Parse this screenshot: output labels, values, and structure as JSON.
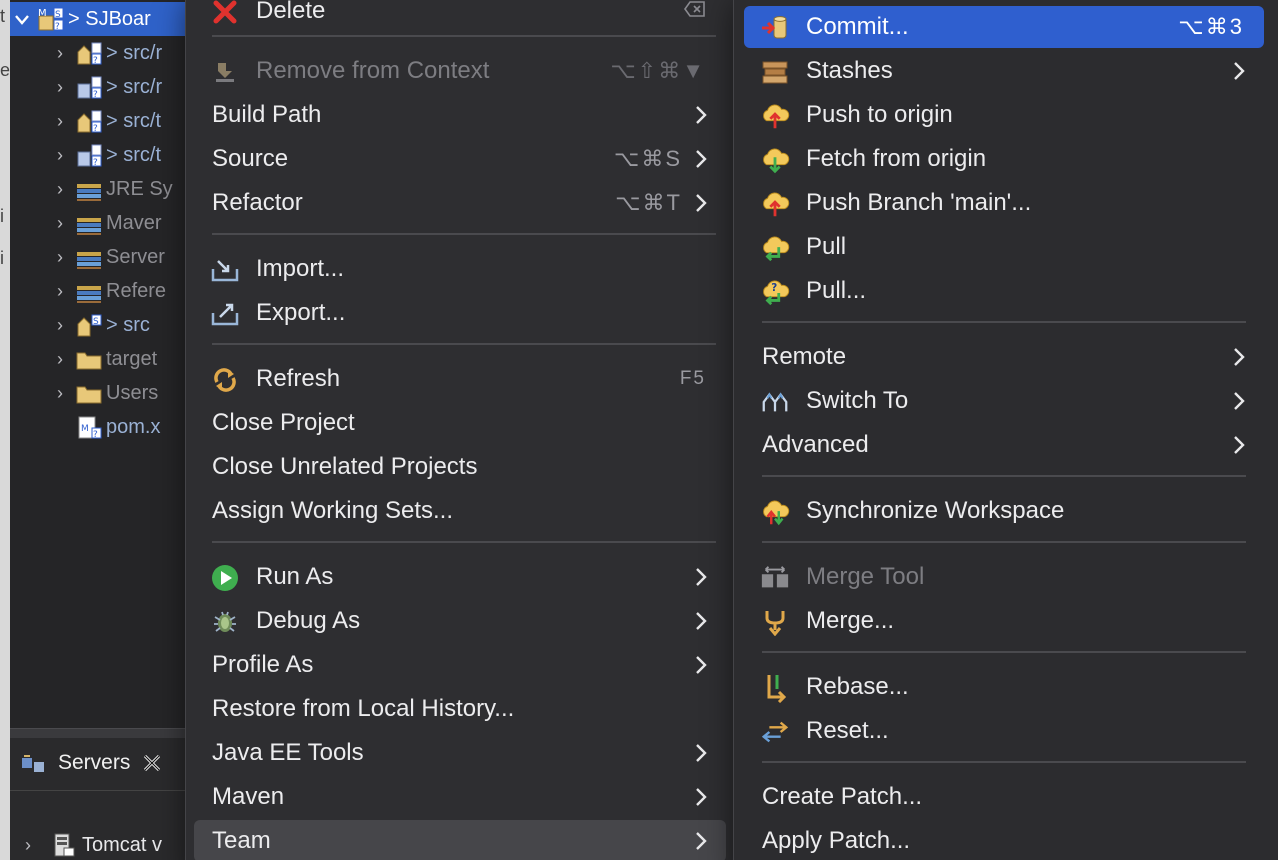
{
  "explorer": {
    "project": "> SJBoar",
    "items": [
      {
        "label": "> src/r",
        "icon": "package-source-icon"
      },
      {
        "label": "> src/r",
        "icon": "package-source-icon"
      },
      {
        "label": "> src/t",
        "icon": "package-source-icon"
      },
      {
        "label": "> src/t",
        "icon": "package-source-icon"
      },
      {
        "label": "JRE Sy",
        "icon": "library-icon"
      },
      {
        "label": "Maver",
        "icon": "library-icon"
      },
      {
        "label": "Server",
        "icon": "library-icon"
      },
      {
        "label": "Refere",
        "icon": "library-icon"
      },
      {
        "label": "> src",
        "icon": "package-source-icon"
      },
      {
        "label": "target",
        "icon": "folder-icon"
      },
      {
        "label": "Users",
        "icon": "folder-icon"
      },
      {
        "label": "pom.x",
        "icon": "xml-file-icon"
      }
    ]
  },
  "servers": {
    "tab_label": "Servers",
    "row_label": "Tomcat v"
  },
  "menu_main": {
    "items": [
      {
        "label": "Delete",
        "icon": "delete-icon"
      },
      {
        "label": "Remove from Context",
        "shortcut": "⌥⇧⌘▼",
        "icon": "remove-context-icon",
        "disabled": true
      },
      {
        "label": "Build Path"
      },
      {
        "label": "Source",
        "shortcut": "⌥⌘S"
      },
      {
        "label": "Refactor",
        "shortcut": "⌥⌘T"
      },
      {
        "label": "Import...",
        "icon": "import-icon"
      },
      {
        "label": "Export...",
        "icon": "export-icon"
      },
      {
        "label": "Refresh",
        "shortcut": "F5",
        "icon": "refresh-icon"
      },
      {
        "label": "Close Project"
      },
      {
        "label": "Close Unrelated Projects"
      },
      {
        "label": "Assign Working Sets..."
      },
      {
        "label": "Run As",
        "icon": "run-icon"
      },
      {
        "label": "Debug As",
        "icon": "debug-icon"
      },
      {
        "label": "Profile As"
      },
      {
        "label": "Restore from Local History..."
      },
      {
        "label": "Java EE Tools"
      },
      {
        "label": "Maven"
      },
      {
        "label": "Team"
      }
    ]
  },
  "menu_team": {
    "items": [
      {
        "label": "Commit...",
        "shortcut": "⌥⌘3",
        "icon": "commit-icon"
      },
      {
        "label": "Stashes",
        "icon": "stash-icon"
      },
      {
        "label": "Push to origin",
        "icon": "push-icon"
      },
      {
        "label": "Fetch from origin",
        "icon": "fetch-icon"
      },
      {
        "label": "Push Branch 'main'...",
        "icon": "push-icon"
      },
      {
        "label": "Pull",
        "icon": "pull-icon"
      },
      {
        "label": "Pull...",
        "icon": "pull-icon"
      },
      {
        "label": "Remote"
      },
      {
        "label": "Switch To",
        "icon": "switch-branch-icon"
      },
      {
        "label": "Advanced"
      },
      {
        "label": "Synchronize Workspace",
        "icon": "synchronize-icon"
      },
      {
        "label": "Merge Tool",
        "icon": "merge-tool-icon",
        "disabled": true
      },
      {
        "label": "Merge...",
        "icon": "merge-icon"
      },
      {
        "label": "Rebase...",
        "icon": "rebase-icon"
      },
      {
        "label": "Reset...",
        "icon": "reset-icon"
      },
      {
        "label": "Create Patch..."
      },
      {
        "label": "Apply Patch..."
      }
    ]
  },
  "colors": {
    "selection": "#2f5fcf",
    "menu_bg": "#2e2e31",
    "text": "#ececee",
    "disabled_text": "#7d7d82"
  }
}
